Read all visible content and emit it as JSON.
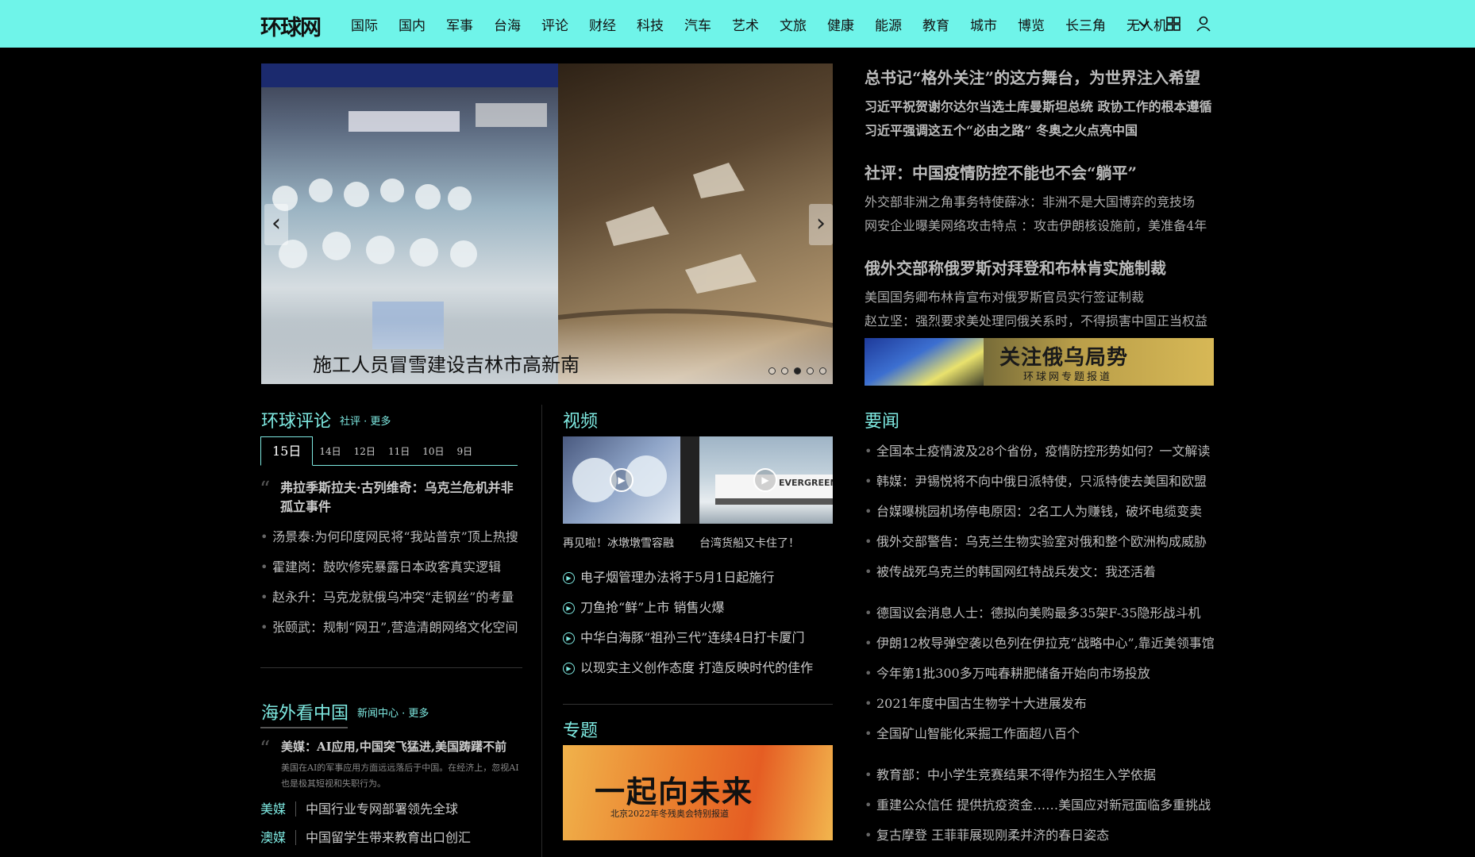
{
  "header": {
    "logo": "环球网",
    "nav": [
      "国际",
      "国内",
      "军事",
      "台海",
      "评论",
      "财经",
      "科技",
      "汽车",
      "艺术",
      "文旅",
      "健康",
      "能源",
      "教育",
      "城市",
      "博览",
      "长三角",
      "无人机"
    ],
    "icons": [
      "chevron-down-icon",
      "grid-icon",
      "user-icon"
    ]
  },
  "carousel": {
    "caption": "施工人员冒雪建设吉林市高新南",
    "slide_count": 5,
    "active_index": 2
  },
  "headlines": [
    {
      "main": "总书记“格外关注”的这方舞台，为世界注入希望",
      "subs": [
        "习近平祝贺谢尔达尔当选土库曼斯坦总统 政协工作的根本遵循",
        "习近平强调这五个“必由之路” 冬奥之火点亮中国"
      ],
      "bold_subs": true
    },
    {
      "main": "社评：中国疫情防控不能也不会“躺平”",
      "subs": [
        "外交部非洲之角事务特使薛冰：非洲不是大国博弈的竞技场",
        "网安企业曝美网络攻击特点 ：攻击伊朗核设施前，美准备4年"
      ],
      "bold_subs": false
    },
    {
      "main": "俄外交部称俄罗斯对拜登和布林肯实施制裁",
      "subs": [
        "美国国务卿布林肯宣布对俄罗斯官员实行签证制裁",
        "赵立坚：强烈要求美处理同俄关系时，不得损害中国正当权益"
      ],
      "bold_subs": false
    }
  ],
  "banner": {
    "title": "关注俄乌局势",
    "subtitle": "环球网专题报道"
  },
  "commentary": {
    "title": "环球评论",
    "links": "社评 · 更多",
    "tabs": [
      "15日",
      "14日",
      "12日",
      "11日",
      "10日",
      "9日"
    ],
    "active_tab": 0,
    "feature": "弗拉季斯拉夫·古列维奇：乌克兰危机并非孤立事件",
    "items": [
      "汤景泰:为何印度网民将“我站普京”顶上热搜",
      "霍建岗：鼓吹修宪暴露日本政客真实逻辑",
      "赵永升：马克龙就俄乌冲突“走钢丝”的考量",
      "张颐武：规制“网丑”,营造清朗网络文化空间"
    ]
  },
  "overseas": {
    "title": "海外看中国",
    "links": "新闻中心 · 更多",
    "feature": "美媒：AI应用,中国突飞猛进,美国踌躇不前",
    "feature_desc": "美国在AI的军事应用方面远远落后于中国。在经济上，忽视AI也是极其短视和失职行为。",
    "rows": [
      {
        "tag": "美媒",
        "text": "中国行业专网部署领先全球"
      },
      {
        "tag": "澳媒",
        "text": "中国留学生带来教育出口创汇"
      }
    ]
  },
  "video": {
    "title": "视频",
    "thumbs": [
      "再见啦！冰墩墩雪容融",
      "台湾货船又卡住了！"
    ],
    "thumb_label": "EVERGREEN",
    "items": [
      "电子烟管理办法将于5月1日起施行",
      "刀鱼抢“鲜”上市 销售火爆",
      "中华白海豚“祖孙三代”连续4日打卡厦门",
      "以现实主义创作态度 打造反映时代的佳作"
    ]
  },
  "topic": {
    "title": "专题",
    "banner_title": "一起向未来",
    "banner_sub": "北京2022年冬残奥会特别报道"
  },
  "news": {
    "title": "要闻",
    "group1": [
      "全国本土疫情波及28个省份，疫情防控形势如何？一文解读",
      "韩媒：尹锡悦将不向中俄日派特使，只派特使去美国和欧盟",
      "台媒曝桃园机场停电原因：2名工人为赚钱，破坏电缆变卖",
      "俄外交部警告：乌克兰生物实验室对俄和整个欧洲构成威胁",
      "被传战死乌克兰的韩国网红特战兵发文：我还活着"
    ],
    "group2": [
      "德国议会消息人士：德拟向美购最多35架F-35隐形战斗机",
      "伊朗12枚导弹空袭以色列在伊拉克“战略中心”,靠近美领事馆",
      "今年第1批300多万吨春耕肥储备开始向市场投放",
      "2021年度中国古生物学十大进展发布",
      "全国矿山智能化采掘工作面超八百个"
    ],
    "group3": [
      "教育部：中小学生竞赛结果不得作为招生入学依据",
      "重建公众信任 提供抗疫资金……美国应对新冠面临多重挑战",
      "复古摩登 王菲菲展现刚柔并济的春日姿态"
    ]
  }
}
